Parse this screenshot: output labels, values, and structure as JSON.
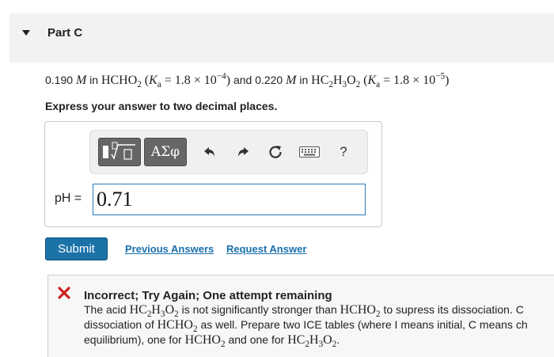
{
  "part": {
    "title": "Part C"
  },
  "question": {
    "conc1": "0.190",
    "unit": "M",
    "in_word": "in",
    "acid1": "HCHO",
    "acid1_sub": "2",
    "ka_label": "K",
    "ka_sub": "a",
    "ka1_mantissa": "1.8",
    "ka1_exp": "−4",
    "and_word": "and",
    "conc2": "0.220",
    "acid2_a": "HC",
    "acid2_sub1": "2",
    "acid2_b": "H",
    "acid2_sub2": "3",
    "acid2_c": "O",
    "acid2_sub3": "2",
    "ka2_mantissa": "1.8",
    "ka2_exp": "−5"
  },
  "instruction": "Express your answer to two decimal places.",
  "toolbar": {
    "templates_icon": "templates-icon",
    "greek_label": "ΑΣφ",
    "undo_icon": "undo-icon",
    "redo_icon": "redo-icon",
    "reset_icon": "reset-icon",
    "keyboard_icon": "keyboard-icon",
    "help_label": "?"
  },
  "answer": {
    "label": "pH =",
    "value": "0.71"
  },
  "actions": {
    "submit_label": "Submit",
    "previous_answers_label": "Previous Answers",
    "request_answer_label": "Request Answer"
  },
  "feedback": {
    "status_icon": "x-icon",
    "title": "Incorrect; Try Again; One attempt remaining",
    "line1_start": "The acid",
    "line1_mid": "is not significantly stronger than",
    "line1_end": "to supress its dissociation. C",
    "line2_start": "dissociation of",
    "line2_end": "as well. Prepare two ICE tables (where I means initial, C means ch",
    "line3_start": "equilibrium), one for",
    "line3_mid": "and one for",
    "line3_end": "."
  },
  "colors": {
    "accent": "#1c73a8",
    "link": "#1a6fae",
    "error": "#d02020",
    "header_bg": "#f2f2f2"
  }
}
